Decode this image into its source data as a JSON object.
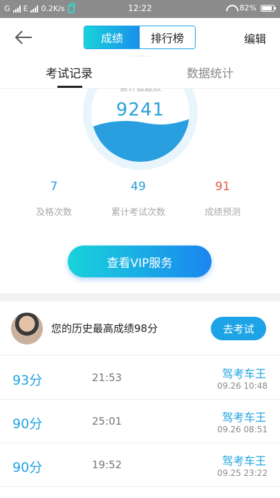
{
  "status_bar": {
    "network_left": "G",
    "network_mid": "E",
    "speed": "0.2K/s",
    "time": "12:22",
    "battery": "82%"
  },
  "header": {
    "tab_score": "成绩",
    "tab_ranking": "排行榜",
    "edit": "编辑"
  },
  "subtabs": {
    "exam_records": "考试记录",
    "data_stats": "数据统计"
  },
  "gauge": {
    "caption": "累计做题数",
    "value": "9241"
  },
  "stats": {
    "pass": {
      "value": "7",
      "label": "及格次数"
    },
    "total": {
      "value": "49",
      "label": "累计考试次数"
    },
    "predict": {
      "value": "91",
      "label": "成绩预测"
    }
  },
  "vip_button": "查看VIP服务",
  "best": {
    "text": "您的历史最高成绩98分",
    "button": "去考试"
  },
  "records": [
    {
      "score": "93分",
      "duration": "21:53",
      "title": "驾考车王",
      "date": "09.26  10:48"
    },
    {
      "score": "90分",
      "duration": "25:01",
      "title": "驾考车王",
      "date": "09.26  08:51"
    },
    {
      "score": "90分",
      "duration": "19:52",
      "title": "驾考车王",
      "date": "09.25  23:22"
    }
  ],
  "colors": {
    "accent": "#1fa3e0",
    "accent_gradient_start": "#19d3da",
    "accent_gradient_end": "#1a86ef",
    "predict": "#e65a47"
  }
}
